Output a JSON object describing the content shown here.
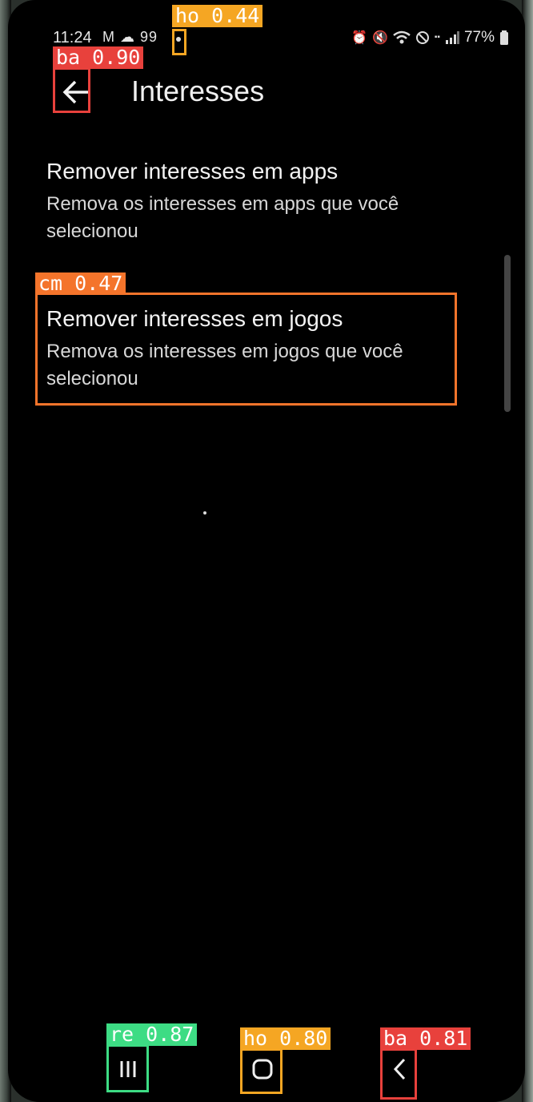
{
  "status_bar": {
    "time": "11:24",
    "left_icons": "M ☁ 99",
    "battery": "77%"
  },
  "header": {
    "title": "Interesses",
    "back_icon": "arrow-left-icon"
  },
  "items": [
    {
      "title": "Remover interesses em apps",
      "subtitle_line1": "Remova os interesses em apps que você",
      "subtitle_line2": "selecionou"
    },
    {
      "title": "Remover interesses em jogos",
      "subtitle_line1": "Remova os interesses em jogos que você",
      "subtitle_line2": "selecionou"
    }
  ],
  "detections": [
    {
      "label": "ho 0.44",
      "color": "#f5a623"
    },
    {
      "label": "ba 0.90",
      "color": "#e8413c"
    },
    {
      "label": "cm 0.47",
      "color": "#f4742b"
    },
    {
      "label": "re 0.87",
      "color": "#3ddc84"
    },
    {
      "label": "ho 0.80",
      "color": "#f5a623"
    },
    {
      "label": "ba 0.81",
      "color": "#e8413c"
    }
  ],
  "nav": {
    "recents_icon": "recents-icon",
    "home_icon": "home-icon",
    "back_icon": "chevron-left-icon"
  }
}
